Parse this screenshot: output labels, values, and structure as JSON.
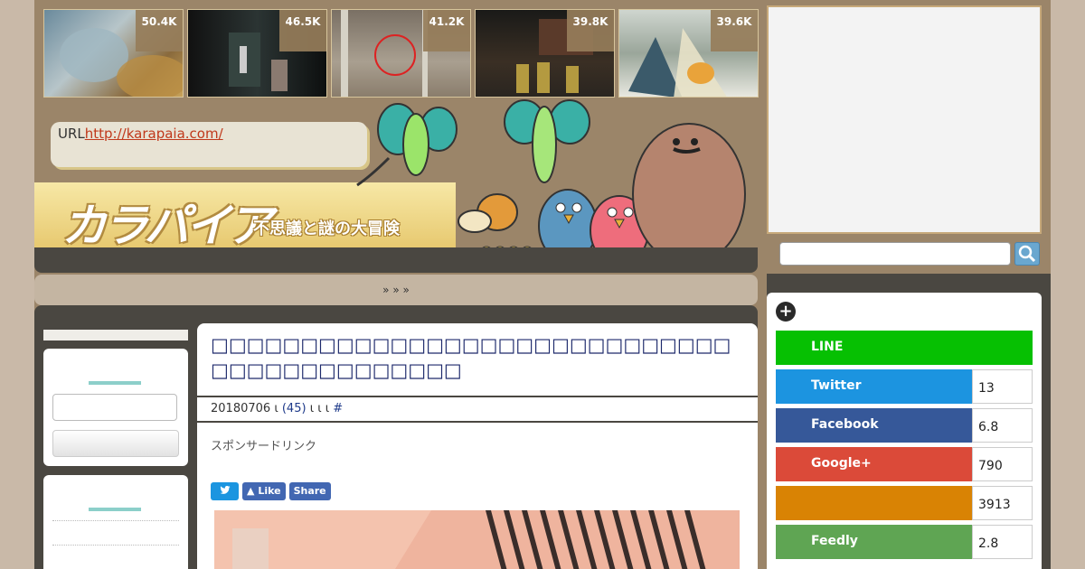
{
  "thumbnails": [
    {
      "count": "50.4K",
      "scene": "macro-bug"
    },
    {
      "count": "46.5K",
      "scene": "dark-hallway"
    },
    {
      "count": "41.2K",
      "scene": "forest-circle"
    },
    {
      "count": "39.8K",
      "scene": "firefighters"
    },
    {
      "count": "39.6K",
      "scene": "plant-glass"
    }
  ],
  "url_bubble": {
    "prefix": "URL",
    "link": "http://karapaia.com/"
  },
  "logo": {
    "main": "カラパイア",
    "sub": "不思議と謎の大冒険"
  },
  "nav": {
    "text": "»  »  »"
  },
  "article": {
    "title": "□□□□□□□□□□□□□□□□□□□□□□□□□□□□□□□□□□□□□□□□□□□",
    "date": "20180706",
    "sep1": "ι",
    "comments": "(45)",
    "sep2": "ι ι ι",
    "hash": "#",
    "sponsor": "スポンサードリンク",
    "share": {
      "twitter_icon": "twitter-bird",
      "fb_like": "Like",
      "fb_share": "Share"
    }
  },
  "search": {
    "placeholder": ""
  },
  "social": [
    {
      "name": "LINE",
      "count": "",
      "color": "#06c002"
    },
    {
      "name": "Twitter",
      "count": "13",
      "color": "#1c94e0"
    },
    {
      "name": "Facebook",
      "count": "6.8",
      "color": "#365899"
    },
    {
      "name": "Google+",
      "count": "790",
      "color": "#db4a39"
    },
    {
      "name": "",
      "count": "3913",
      "color": "#d98304"
    },
    {
      "name": "Feedly",
      "count": "2.8",
      "color": "#5fa553"
    }
  ]
}
